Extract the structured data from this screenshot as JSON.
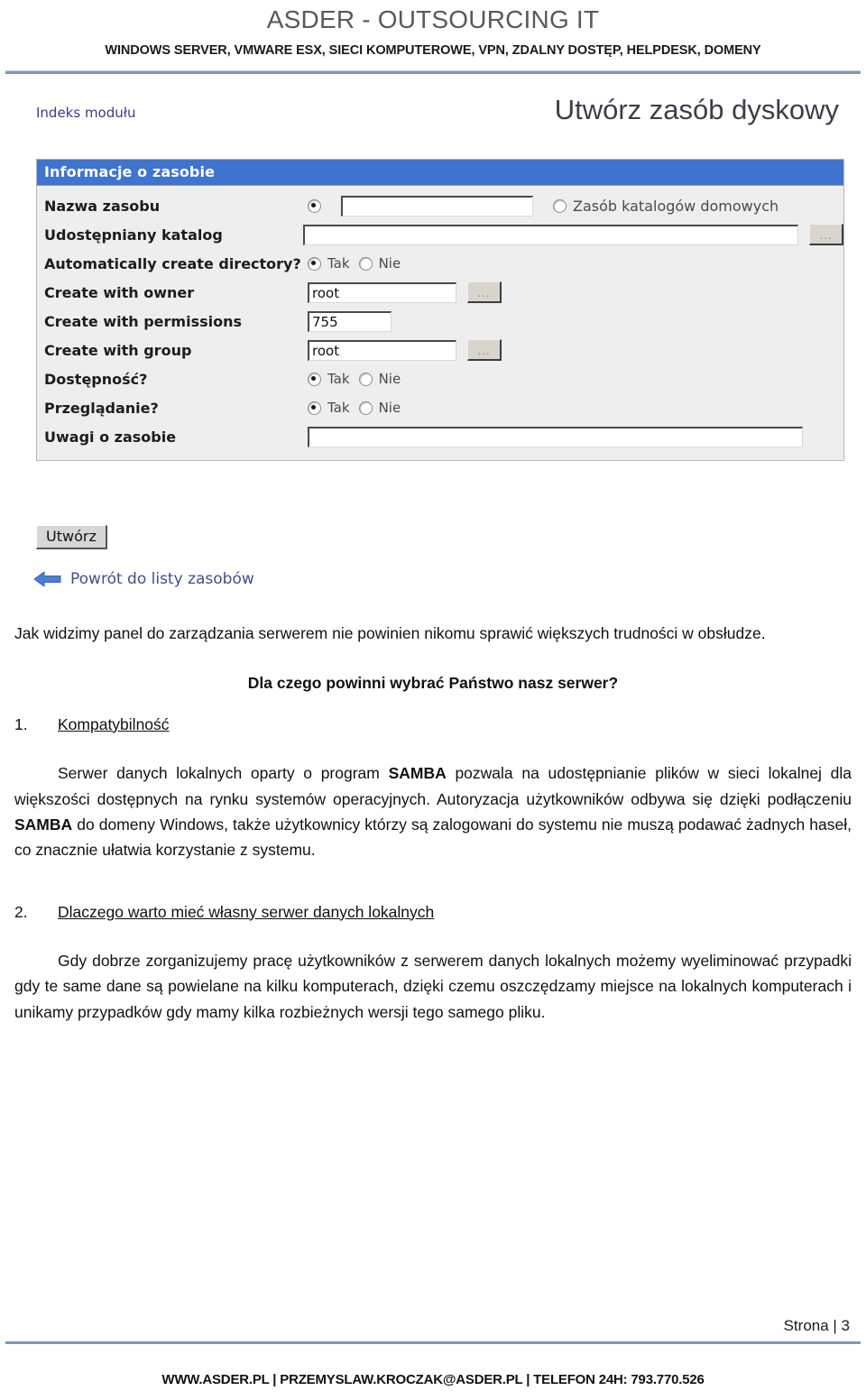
{
  "header": {
    "brand_title": "ASDER - OUTSOURCING IT",
    "brand_subtitle": "WINDOWS SERVER, VMWARE ESX, SIECI KOMPUTEROWE, VPN, ZDALNY DOSTĘP, HELPDESK, DOMENY",
    "rule_color": "#8096b4",
    "title_color": "#595959"
  },
  "screenshot": {
    "index_link": "Indeks modułu",
    "page_title": "Utwórz zasób dyskowy",
    "panel_header": "Informacje o zasobie",
    "panel_header_color": "#3f74cf",
    "fields": {
      "share_name_label": "Nazwa zasobu",
      "share_name_value": "",
      "home_shares_label": "Zasób katalogów domowych",
      "directory_label": "Udostępniany katalog",
      "directory_value": "",
      "auto_create_label": "Automatically create directory?",
      "owner_label": "Create with owner",
      "owner_value": "root",
      "permissions_label": "Create with permissions",
      "permissions_value": "755",
      "group_label": "Create with group",
      "group_value": "root",
      "available_label": "Dostępność?",
      "browseable_label": "Przeglądanie?",
      "comment_label": "Uwagi o zasobie",
      "comment_value": ""
    },
    "radio_yes": "Tak",
    "radio_no": "Nie",
    "browse_button": "...",
    "create_button": "Utwórz",
    "back_link": "Powrót do listy zasobów"
  },
  "body": {
    "intro_paragraph": "Jak widzimy panel do zarządzania serwerem nie powinien nikomu sprawić większych trudności w obsłudze.",
    "question_heading": "Dla czego powinni wybrać Państwo nasz serwer?",
    "section1_number": "1.",
    "section1_title": "Kompatybilność",
    "section1_p1_a": "Serwer danych lokalnych oparty o program ",
    "section1_p1_b": "SAMBA",
    "section1_p1_c": " pozwala na udostępnianie plików w sieci lokalnej dla większości dostępnych na rynku systemów operacyjnych. Autoryzacja użytkowników odbywa się dzięki podłączeniu ",
    "section1_p1_d": "SAMBA",
    "section1_p1_e": " do domeny Windows, także użytkownicy którzy są zalogowani do systemu nie muszą podawać żadnych haseł, co znacznie ułatwia korzystanie z systemu.",
    "section2_number": "2.",
    "section2_title": "Dlaczego warto mieć własny serwer danych lokalnych",
    "section2_p1": "Gdy dobrze zorganizujemy pracę użytkowników z serwerem danych lokalnych możemy wyeliminować przypadki gdy te same dane są  powielane na kilku komputerach, dzięki czemu oszczędzamy miejsce na lokalnych komputerach i unikamy przypadków gdy mamy kilka rozbieżnych wersji tego samego pliku."
  },
  "footer": {
    "page_label": "Strona | 3",
    "contact": "WWW.ASDER.PL | PRZEMYSLAW.KROCZAK@ASDER.PL | TELEFON 24H: 793.770.526"
  }
}
